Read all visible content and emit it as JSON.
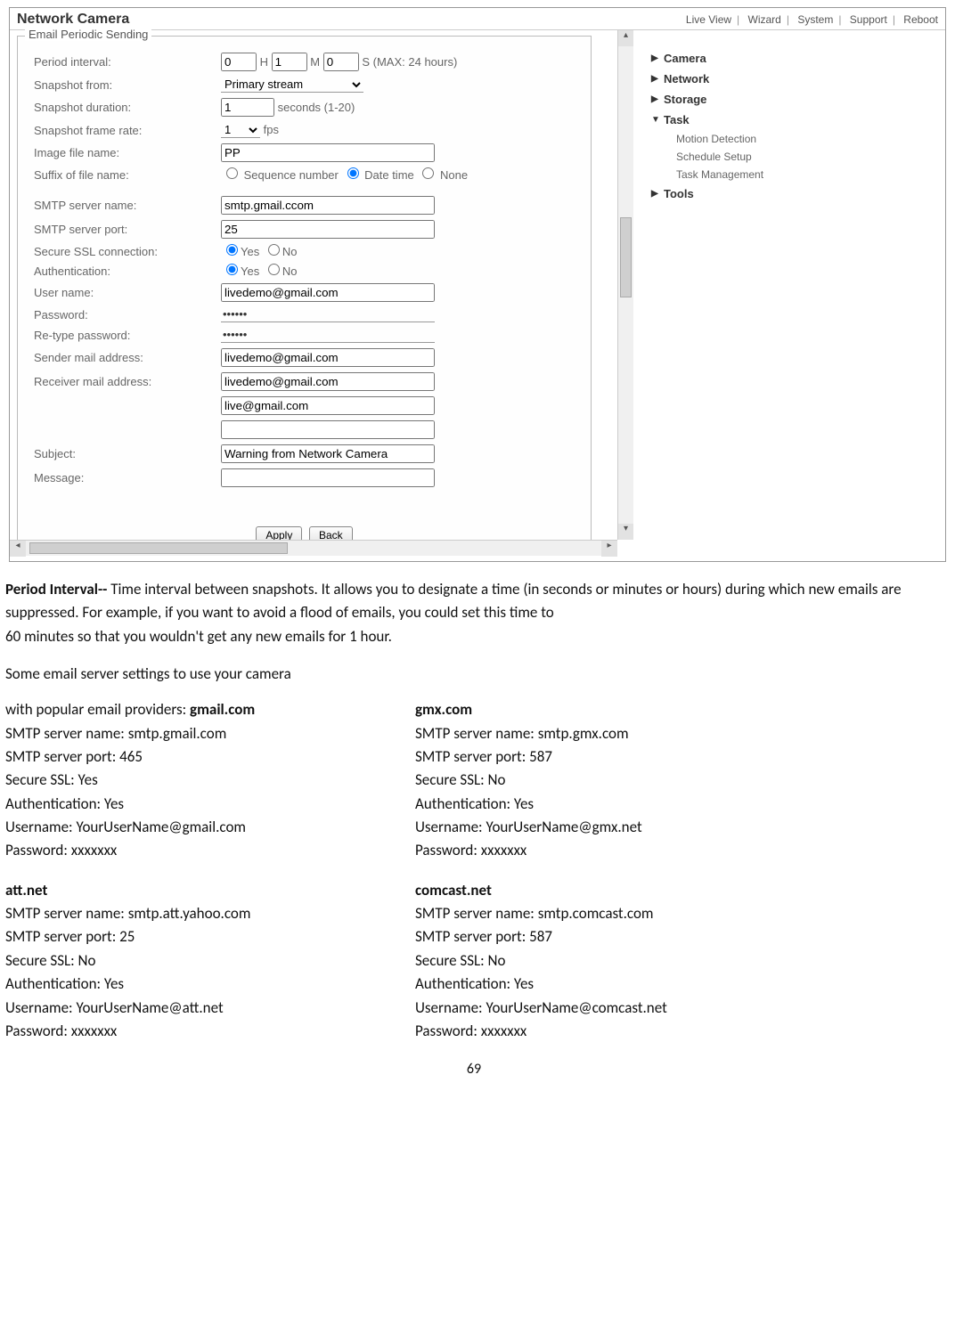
{
  "app": {
    "title": "Network Camera",
    "nav": [
      "Live View",
      "Wizard",
      "System",
      "Support",
      "Reboot"
    ]
  },
  "form": {
    "group_title": "Email Periodic Sending",
    "period_interval_label": "Period interval:",
    "period_h": "0",
    "period_h_unit": "H",
    "period_m": "1",
    "period_m_unit": "M",
    "period_s": "0",
    "period_s_unit": "S (MAX: 24 hours)",
    "snapshot_from_label": "Snapshot from:",
    "snapshot_from_value": "Primary stream",
    "snapshot_duration_label": "Snapshot duration:",
    "snapshot_duration_value": "1",
    "snapshot_duration_suffix": "seconds (1-20)",
    "snapshot_rate_label": "Snapshot frame rate:",
    "snapshot_rate_value": "1",
    "snapshot_rate_suffix": "fps",
    "image_file_label": "Image file name:",
    "image_file_value": "PP",
    "suffix_label": "Suffix of file name:",
    "suffix_seq": "Sequence number",
    "suffix_date": "Date time",
    "suffix_none": "None",
    "smtp_server_label": "SMTP server name:",
    "smtp_server_value": "smtp.gmail.ccom",
    "smtp_port_label": "SMTP server port:",
    "smtp_port_value": "25",
    "ssl_label": "Secure SSL connection:",
    "auth_label": "Authentication:",
    "yes": "Yes",
    "no": "No",
    "user_label": "User name:",
    "user_value": "livedemo@gmail.com",
    "pwd_label": "Password:",
    "pwd_value": "••••••",
    "pwd2_label": "Re-type password:",
    "pwd2_value": "••••••",
    "sender_label": "Sender mail address:",
    "sender_value": "livedemo@gmail.com",
    "receiver_label": "Receiver mail address:",
    "receiver_value": "livedemo@gmail.com",
    "receiver2_value": "live@gmail.com",
    "subject_label": "Subject:",
    "subject_value": "Warning from Network Camera",
    "message_label": "Message:",
    "apply": "Apply",
    "back": "Back"
  },
  "side": {
    "camera": "Camera",
    "network": "Network",
    "storage": "Storage",
    "task": "Task",
    "task_children": [
      "Motion Detection",
      "Schedule Setup",
      "Task Management"
    ],
    "tools": "Tools"
  },
  "doc": {
    "p1a": "Period Interval-- ",
    "p1b": "Time interval between snapshots. It allows you to designate a time (in seconds or minutes or hours) during which new emails are suppressed. For example, if you want to avoid a flood of emails, you could set this time to",
    "p2": "60 minutes so that you wouldn't get any new emails for 1 hour.",
    "intro": "Some email server settings to use your camera",
    "intro2": "with popular email providers: ",
    "providers": [
      {
        "name": "gmail.com",
        "server": "SMTP server name: smtp.gmail.com",
        "port": "SMTP server port: 465",
        "ssl": "Secure SSL: Yes",
        "auth": "Authentication: Yes",
        "user": "Username: YourUserName@gmail.com",
        "pwd": "Password: xxxxxxx"
      },
      {
        "name": "gmx.com",
        "server": "SMTP server name: smtp.gmx.com",
        "port": "SMTP server port: 587",
        "ssl": "Secure SSL: No",
        "auth": "Authentication: Yes",
        "user": "Username: YourUserName@gmx.net",
        "pwd": "Password: xxxxxxx"
      },
      {
        "name": "att.net",
        "server": "SMTP server name: smtp.att.yahoo.com",
        "port": "SMTP server port: 25",
        "ssl": "Secure SSL: No",
        "auth": "Authentication: Yes",
        "user": "Username: YourUserName@att.net",
        "pwd": "Password: xxxxxxx"
      },
      {
        "name": "comcast.net",
        "server": "SMTP server name: smtp.comcast.com",
        "port": "SMTP server port: 587",
        "ssl": "Secure SSL: No",
        "auth": "Authentication: Yes",
        "user": "Username: YourUserName@comcast.net",
        "pwd": "Password: xxxxxxx"
      }
    ],
    "pagenum": "69"
  }
}
